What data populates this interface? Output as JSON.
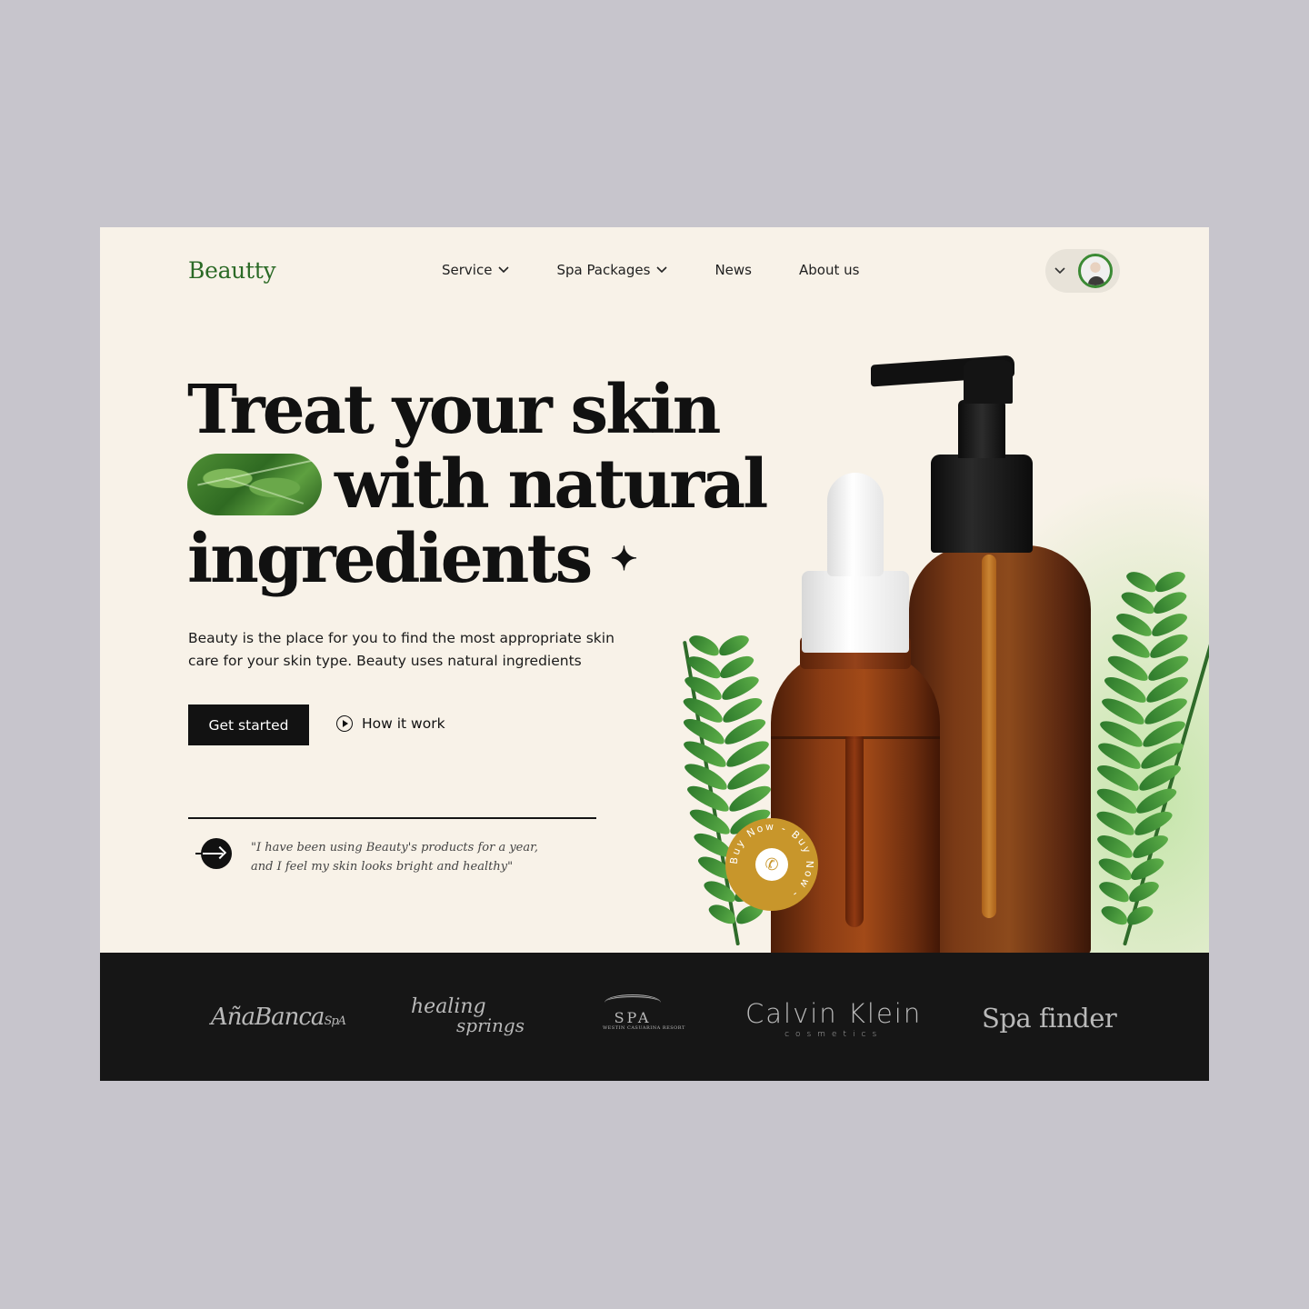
{
  "brand": {
    "name": "Beautty",
    "color": "#2b6a26"
  },
  "nav": {
    "items": [
      {
        "label": "Service",
        "has_dropdown": true
      },
      {
        "label": "Spa Packages",
        "has_dropdown": true
      },
      {
        "label": "News",
        "has_dropdown": false
      },
      {
        "label": "About us",
        "has_dropdown": false
      }
    ]
  },
  "profile": {
    "icon": "chevron-down-icon",
    "avatar": "user-avatar"
  },
  "hero": {
    "headline_1": "Treat your skin",
    "headline_2": "with natural",
    "headline_3": "ingredients",
    "sparkle": "✦",
    "description": "Beauty is the place for you to find the most appropriate skin care for your skin type. Beauty uses natural ingredients",
    "cta_primary": "Get started",
    "cta_secondary": "How it work"
  },
  "testimonial": {
    "quote": "\"I have been using Beauty's products for a year, and I feel my skin looks bright and healthy\""
  },
  "badge": {
    "text": "Buy Now - Buy Now -",
    "icon": "phone-icon",
    "color": "#c8962b"
  },
  "partners": {
    "logo1": "AñaBanca",
    "logo1_suffix": "SpA",
    "logo2_line1": "healing",
    "logo2_line2": "springs",
    "logo3": "SPA",
    "logo3_sub": "WESTIN CASUARINA RESORT",
    "logo4": "Calvin Klein",
    "logo4_sub": "cosmetics",
    "logo5": "Spa finder"
  },
  "colors": {
    "page_bg": "#c7c5cc",
    "hero_bg": "#f8f2e8",
    "strip_bg": "#161616",
    "accent_gold": "#c8962b"
  }
}
